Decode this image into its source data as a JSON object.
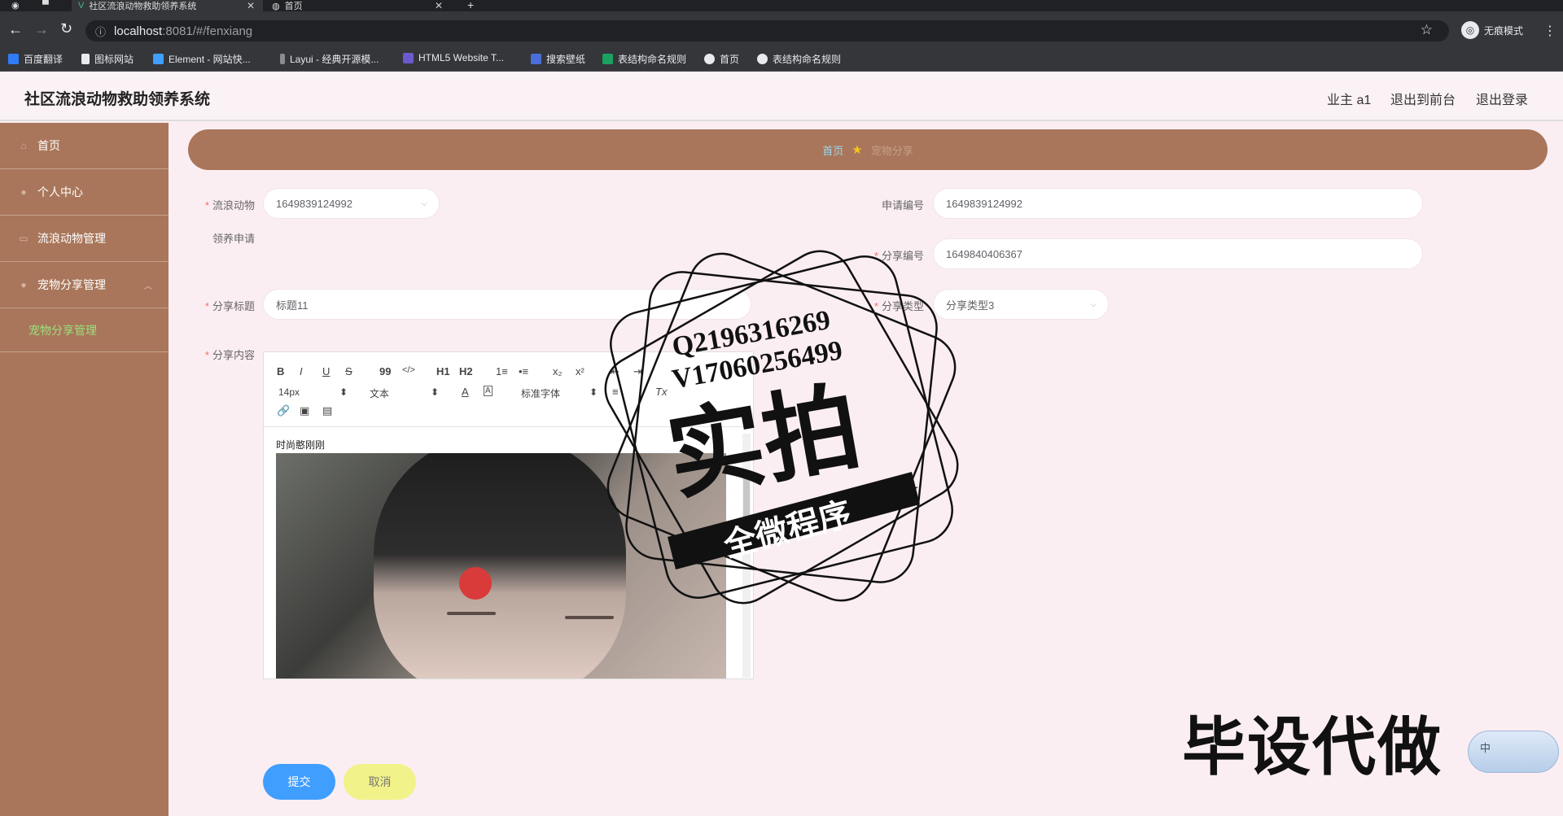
{
  "browser": {
    "tabs": [
      {
        "title": "社区流浪动物救助领养系统",
        "active": true
      },
      {
        "title": "首页",
        "active": false
      }
    ],
    "url_host": "localhost",
    "url_rest": ":8081/#/fenxiang",
    "profile_label": "无痕模式",
    "bookmarks": [
      "百度翻译",
      "图标网站",
      "Element - 网站快...",
      "Layui - 经典开源模...",
      "HTML5 Website T...",
      "搜索壁纸",
      "表结构命名规则",
      "首页",
      "表结构命名规则"
    ]
  },
  "header": {
    "title": "社区流浪动物救助领养系统",
    "user": "业主 a1",
    "front": "退出到前台",
    "logout": "退出登录"
  },
  "sidebar": {
    "items": [
      {
        "label": "首页"
      },
      {
        "label": "个人中心"
      },
      {
        "label": "流浪动物管理"
      },
      {
        "label": "宠物分享管理"
      }
    ],
    "sub": "宠物分享管理"
  },
  "breadcrumb": {
    "home": "首页",
    "current": "宠物分享"
  },
  "form": {
    "animal_label": "流浪动物",
    "animal_value": "1649839124992",
    "apply_label": "领养申请",
    "apply_no_label": "申请编号",
    "apply_no_value": "1649839124992",
    "share_no_label": "分享编号",
    "share_no_value": "1649840406367",
    "title_label": "分享标题",
    "title_value": "标题11",
    "type_label": "分享类型",
    "type_value": "分享类型3",
    "content_label": "分享内容"
  },
  "editor": {
    "row1": [
      "B",
      "I",
      "U",
      "S",
      "99",
      "</>",
      "H1",
      "H2",
      "1≡",
      "•≡",
      "x₂",
      "x²",
      "⇤",
      "⇥"
    ],
    "size": "14px",
    "text_type": "文本",
    "font": "标准字体",
    "clear": "Tx",
    "content_text": "时尚憨刚刚"
  },
  "buttons": {
    "submit": "提交",
    "cancel": "取消"
  },
  "overlay": {
    "stamp_line1": "Q2196316269",
    "stamp_line2": "V17060256499",
    "stamp_big": "实拍",
    "stamp_banner": "全微程序",
    "watermark": "毕设代做",
    "ime_label": "中"
  }
}
